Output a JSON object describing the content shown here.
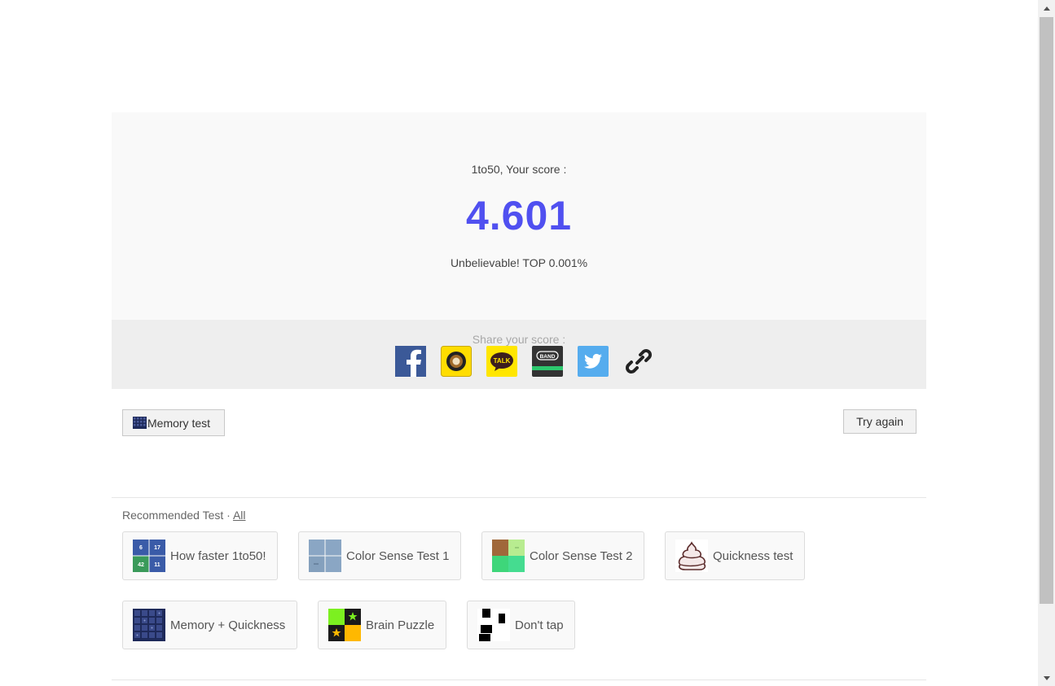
{
  "result": {
    "score_label": "1to50, Your score :",
    "score_value": "4.601",
    "rank_text": "Unbelievable! TOP 0.001%"
  },
  "share": {
    "label": "Share your score :",
    "icons": [
      "facebook-icon",
      "kakaostory-icon",
      "kakaotalk-icon",
      "band-icon",
      "twitter-icon",
      "link-icon"
    ],
    "kakaotalk_text": "TALK",
    "band_text": "BAND"
  },
  "actions": {
    "memory_label": "Memory test",
    "try_again_label": "Try again"
  },
  "recommended": {
    "title": "Recommended Test",
    "separator": "·",
    "all_link": "All",
    "tests": [
      {
        "label": "How faster 1to50!",
        "icon": "1to50-grid-icon",
        "thumb_numbers": [
          "6",
          "17",
          "42",
          "11"
        ]
      },
      {
        "label": "Color Sense Test 1",
        "icon": "color-sense-1-icon"
      },
      {
        "label": "Color Sense Test 2",
        "icon": "color-sense-2-icon"
      },
      {
        "label": "Quickness test",
        "icon": "quickness-icon"
      },
      {
        "label": "Memory + Quickness",
        "icon": "memory-quickness-icon"
      },
      {
        "label": "Brain Puzzle",
        "icon": "brain-puzzle-icon"
      },
      {
        "label": "Don't tap",
        "icon": "dont-tap-icon"
      }
    ]
  },
  "colors": {
    "score": "#5050f0",
    "result_bg": "#f9f9f9",
    "share_bg": "#eeeeee"
  }
}
